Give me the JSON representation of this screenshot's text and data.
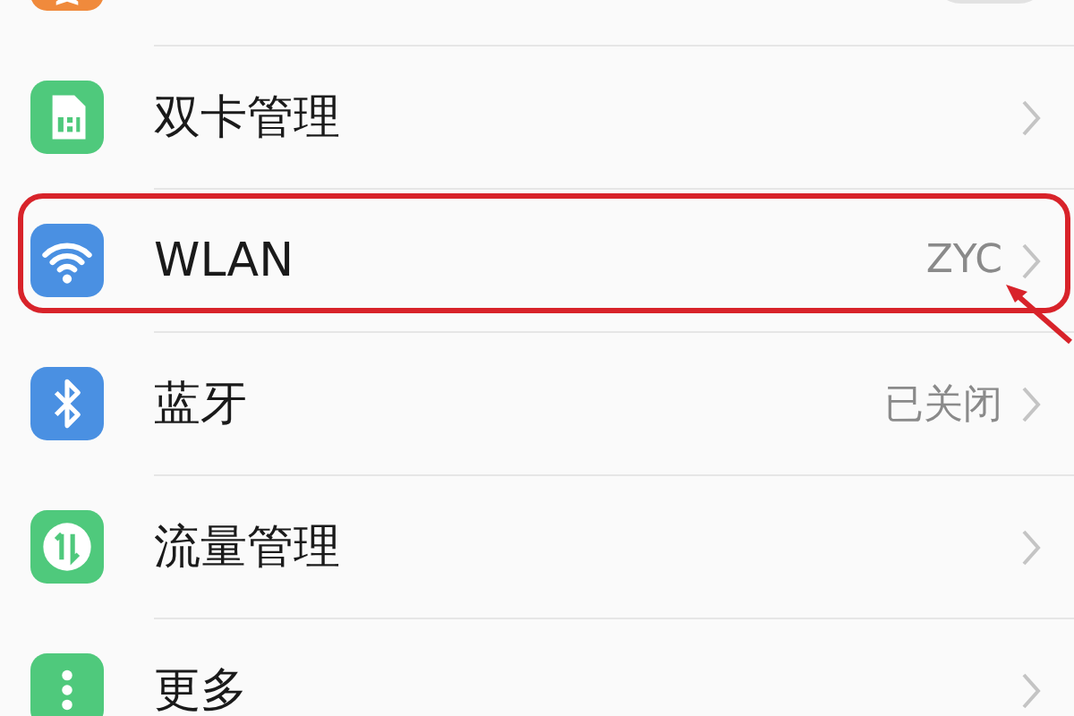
{
  "settings": [
    {
      "kind": "toggle",
      "color": "#f08a3c",
      "on": false,
      "highlighted": false
    },
    {
      "kind": "link",
      "label": "双卡管理",
      "color": "#4fc97c",
      "highlighted": false
    },
    {
      "kind": "link",
      "label": "WLAN",
      "value": "ZYC",
      "color": "#4a90e2",
      "highlighted": true
    },
    {
      "kind": "link",
      "label": "蓝牙",
      "value": "已关闭",
      "color": "#4a90e2",
      "highlighted": false
    },
    {
      "kind": "link",
      "label": "流量管理",
      "color": "#4fc97c",
      "highlighted": false
    },
    {
      "kind": "link",
      "label": "更多",
      "color": "#4fc97c",
      "highlighted": false
    }
  ]
}
